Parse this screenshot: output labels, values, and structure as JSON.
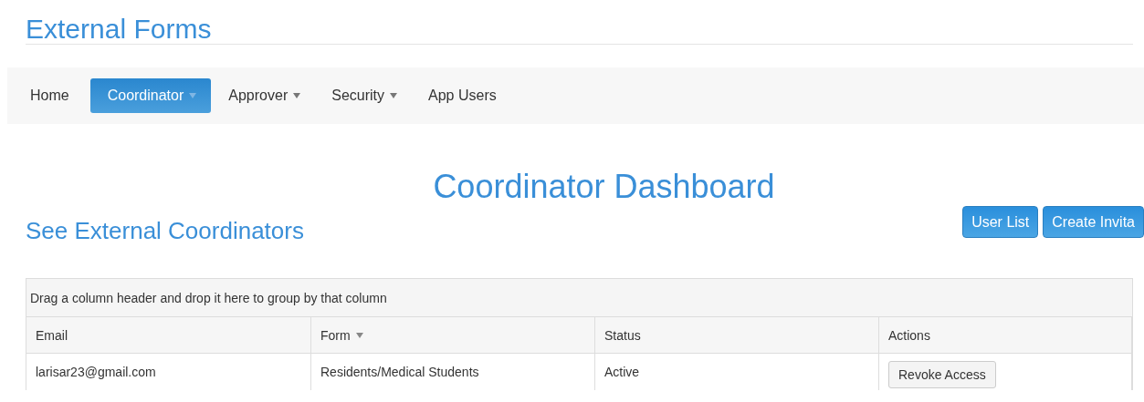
{
  "app_title": "External Forms",
  "nav": [
    {
      "label": "Home",
      "selected": false,
      "dropdown": false
    },
    {
      "label": "Coordinator",
      "selected": true,
      "dropdown": true
    },
    {
      "label": "Approver",
      "selected": false,
      "dropdown": true
    },
    {
      "label": "Security",
      "selected": false,
      "dropdown": true
    },
    {
      "label": "App Users",
      "selected": false,
      "dropdown": false
    }
  ],
  "page_title": "Coordinator Dashboard",
  "section_title": "See External Coordinators",
  "buttons": [
    "User List",
    "Create Invita"
  ],
  "grid": {
    "group_hint": "Drag a column header and drop it here to group by that column",
    "columns": [
      {
        "label": "Email",
        "filter": false
      },
      {
        "label": "Form",
        "filter": true
      },
      {
        "label": "Status",
        "filter": false
      },
      {
        "label": "Actions",
        "filter": false
      }
    ],
    "rows": [
      {
        "email": "larisar23@gmail.com",
        "form": "Residents/Medical Students",
        "status": "Active",
        "action": "Revoke Access"
      }
    ]
  }
}
